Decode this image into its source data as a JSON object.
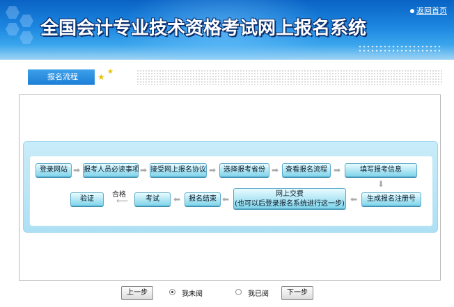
{
  "header": {
    "title": "全国会计专业技术资格考试网上报名系统",
    "home_link": "返回首页"
  },
  "breadcrumb": {
    "label": "报名流程"
  },
  "flow": {
    "row1": [
      "登录网站",
      "报考人员必读事项",
      "接受网上报名协议",
      "选择报考省份",
      "查看报名流程",
      "填写报考信息"
    ],
    "row2": [
      "生成报名注册号",
      "网上交费",
      "(也可以后登录报名系统进行这一步)",
      "报名结束",
      "考试",
      "验证"
    ],
    "pass_label": "合格"
  },
  "footer": {
    "prev_label": "上一步",
    "radio_unread": "我未阅",
    "radio_read": "我已阅",
    "next_label": "下一步",
    "selected": "unread"
  }
}
